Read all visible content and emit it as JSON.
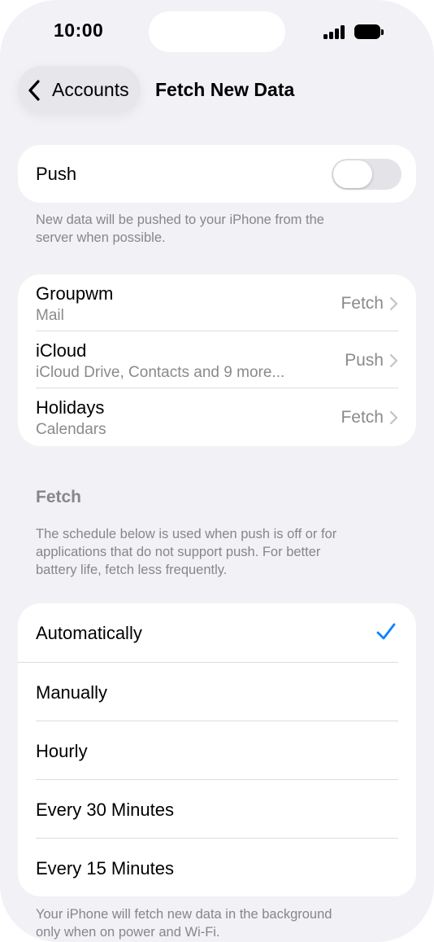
{
  "status_bar": {
    "time": "10:00"
  },
  "nav": {
    "back_label": "Accounts",
    "title": "Fetch New Data"
  },
  "push": {
    "label": "Push",
    "enabled": false,
    "footnote_line1": "New data will be pushed to your iPhone from the",
    "footnote_line2": "server when possible."
  },
  "accounts": [
    {
      "title": "Groupwm",
      "subtitle": "Mail",
      "value": "Fetch"
    },
    {
      "title": "iCloud",
      "subtitle": "iCloud Drive, Contacts and 9 more...",
      "value": "Push"
    },
    {
      "title": "Holidays",
      "subtitle": "Calendars",
      "value": "Fetch"
    }
  ],
  "fetch_section": {
    "header": "Fetch",
    "desc_line1": "The schedule below is used when push is off or for",
    "desc_line2": "applications that do not support push. For better",
    "desc_line3": "battery life, fetch less frequently."
  },
  "schedule_options": [
    {
      "label": "Automatically",
      "selected": true
    },
    {
      "label": "Manually",
      "selected": false
    },
    {
      "label": "Hourly",
      "selected": false
    },
    {
      "label": "Every 30 Minutes",
      "selected": false
    },
    {
      "label": "Every 15 Minutes",
      "selected": false
    }
  ],
  "bottom_note": {
    "line1": "Your iPhone will fetch new data in the background",
    "line2": "only when on power and Wi-Fi."
  },
  "colors": {
    "accent": "#0a84ff",
    "background": "#f2f1f6",
    "secondary_text": "#86868b"
  }
}
